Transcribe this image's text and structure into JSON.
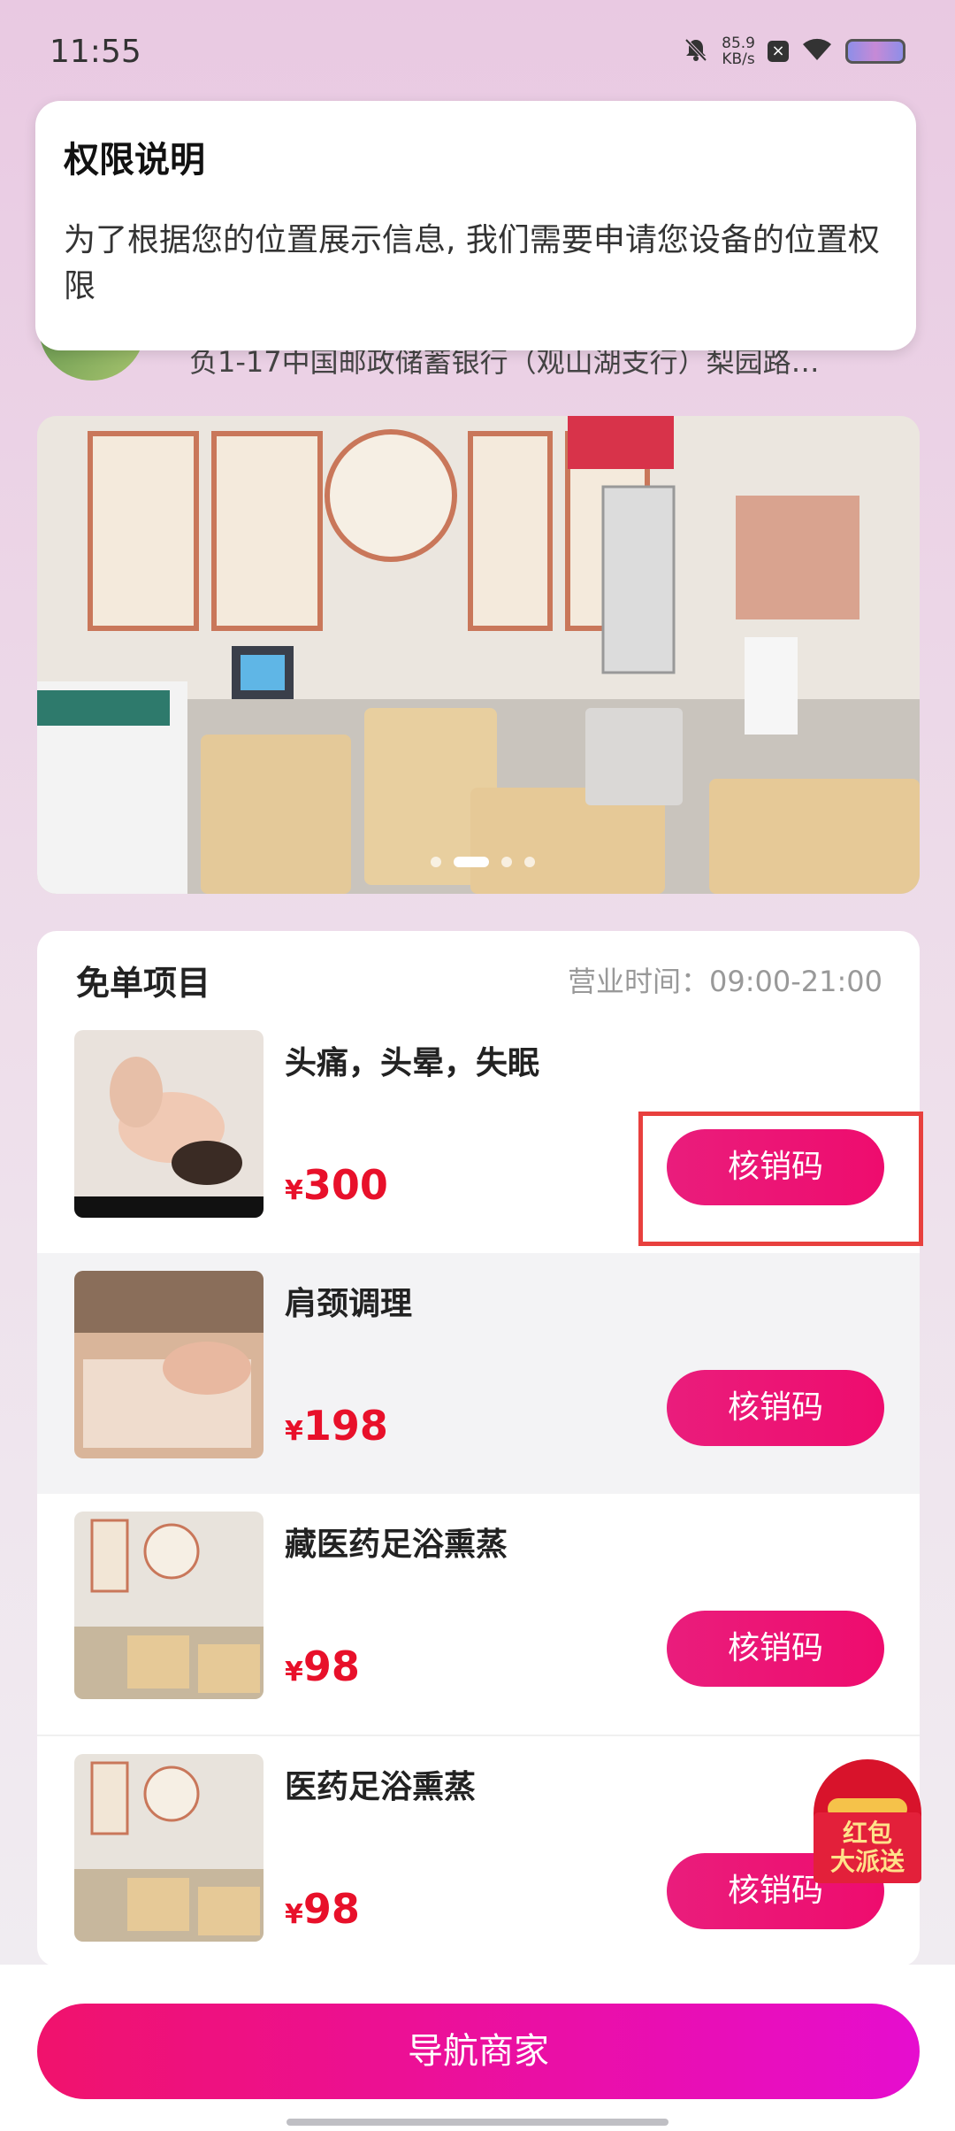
{
  "status_bar": {
    "time": "11:55",
    "net_speed_value": "85.9",
    "net_speed_unit": "KB/s"
  },
  "permission_dialog": {
    "title": "权限说明",
    "message": "为了根据您的位置展示信息, 我们需要申请您设备的位置权限"
  },
  "store": {
    "address": "负1-17中国邮政储蓄银行（观山湖支行）梨园路…"
  },
  "banner": {
    "image_alt": "店内环境照片：足浴熏蒸桶与四季养生挂画",
    "dots": 4,
    "active_dot": 1
  },
  "free_items": {
    "title": "免单项目",
    "hours": "营业时间：09:00-21:00",
    "items": [
      {
        "name": "头痛，头晕，失眠",
        "currency": "¥",
        "price": "300",
        "button": "核销码"
      },
      {
        "name": "肩颈调理",
        "currency": "¥",
        "price": "198",
        "button": "核销码"
      },
      {
        "name": "藏医药足浴熏蒸",
        "currency": "¥",
        "price": "98",
        "button": "核销码"
      },
      {
        "name": "医药足浴熏蒸",
        "currency": "¥",
        "price": "98",
        "button": "核销码"
      }
    ]
  },
  "red_packet": {
    "line1": "红包",
    "line2": "大派送"
  },
  "bottom": {
    "nav_button": "导航商家"
  }
}
